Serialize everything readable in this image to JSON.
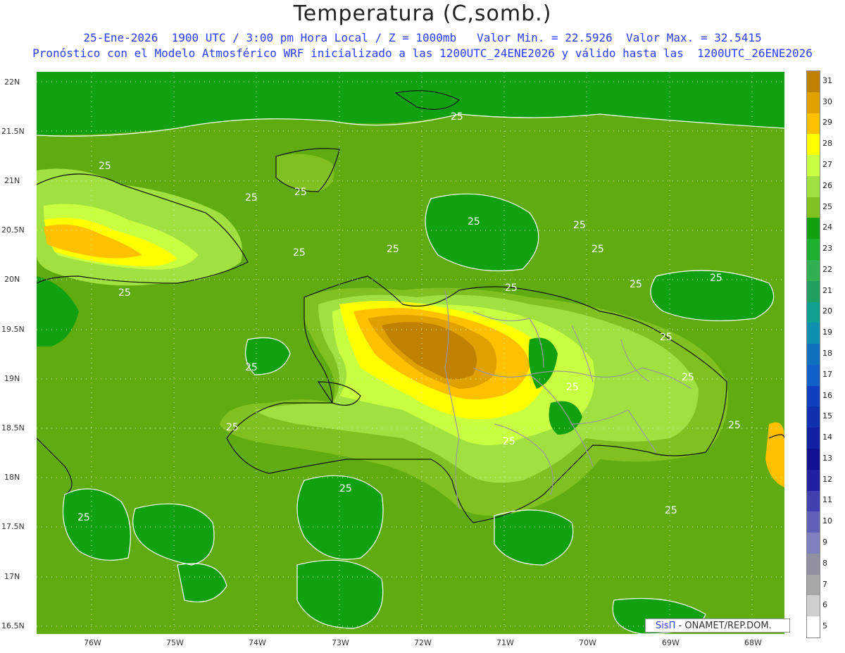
{
  "header": {
    "title": "Temperatura (C,somb.)",
    "line1": "25-Ene-2026  1900 UTC / 3:00 pm Hora Local / Z = 1000mb   Valor Min. = 22.5926  Valor Max. = 32.5415",
    "line2": "Pronóstico con el Modelo Atmosférico WRF inicializado a las 1200UTC_24ENE2026 y válido hasta las  1200UTC_26ENE2026"
  },
  "axes": {
    "lat_labels": [
      "22N",
      "21.5N",
      "21N",
      "20.5N",
      "20N",
      "19.5N",
      "19N",
      "18.5N",
      "18N",
      "17.5N",
      "17N",
      "16.5N"
    ],
    "lon_labels": [
      "76W",
      "75W",
      "74W",
      "73W",
      "72W",
      "71W",
      "70W",
      "69W",
      "68W"
    ]
  },
  "contour_labels": [
    "25",
    "25",
    "25",
    "25",
    "25",
    "25",
    "25",
    "25",
    "25",
    "25",
    "25",
    "25",
    "25",
    "25",
    "25",
    "25",
    "25",
    "25",
    "25",
    "25",
    "25",
    "25",
    "25"
  ],
  "colorbar": {
    "labels": [
      "31",
      "30",
      "29",
      "28",
      "27",
      "26",
      "25",
      "24",
      "23",
      "22",
      "21",
      "20",
      "19",
      "18",
      "17",
      "16",
      "15",
      "14",
      "13",
      "12",
      "11",
      "10",
      "9",
      "8",
      "7",
      "6",
      "5"
    ],
    "colors": [
      "#c08000",
      "#e0a000",
      "#ffc000",
      "#ffff00",
      "#c8ff40",
      "#a0e040",
      "#80c020",
      "#10a010",
      "#20b030",
      "#30b050",
      "#20a060",
      "#10a090",
      "#1090b0",
      "#1070c0",
      "#1060c8",
      "#1040c0",
      "#1030b0",
      "#1020a0",
      "#101090",
      "#2020a0",
      "#4040b0",
      "#6060b8",
      "#8080c0",
      "#9090a0",
      "#a8a8a8",
      "#d0d0d0",
      "#ffffff"
    ]
  },
  "credit": {
    "brand": "SisΠ",
    "text": " - ONAMET/REP.DOM."
  },
  "colors": {
    "ocean": "#60ac10",
    "land_warm": "#e0a000",
    "header_blue": "#2a3cff"
  }
}
